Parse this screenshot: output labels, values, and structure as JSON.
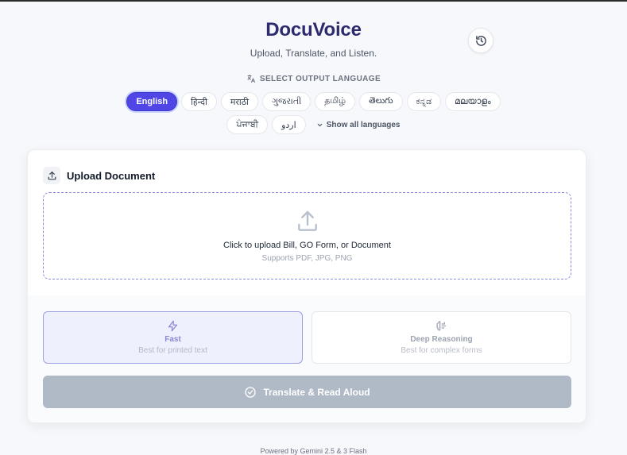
{
  "app": {
    "title": "DocuVoice",
    "subtitle": "Upload, Translate, and Listen."
  },
  "history_button": {
    "icon": "history-icon"
  },
  "language": {
    "heading": "SELECT OUTPUT LANGUAGE",
    "selected": "English",
    "options_row1": [
      "English",
      "हिन्दी",
      "मराठी",
      "ગુજરાતી",
      "தமிழ்",
      "తెలుగు",
      "ಕನ್ನಡ",
      "മലയാളം"
    ],
    "options_row2": [
      "ਪੰਜਾਬੀ",
      "اردو"
    ],
    "show_all": "Show all languages"
  },
  "upload": {
    "title": "Upload Document",
    "dropzone_title": "Click to upload Bill, GO Form, or Document",
    "dropzone_sub": "Supports PDF, JPG, PNG"
  },
  "modes": {
    "selected": "Fast",
    "fast": {
      "title": "Fast",
      "desc": "Best for printed text"
    },
    "deep": {
      "title": "Deep Reasoning",
      "desc": "Best for complex forms"
    }
  },
  "submit": {
    "label": "Translate & Read Aloud",
    "disabled": true
  },
  "footer": "Powered by Gemini 2.5 & 3 Flash",
  "colors": {
    "accent": "#4f46e5",
    "title": "#2e2a6e",
    "disabled_button": "#b0b9c6"
  }
}
